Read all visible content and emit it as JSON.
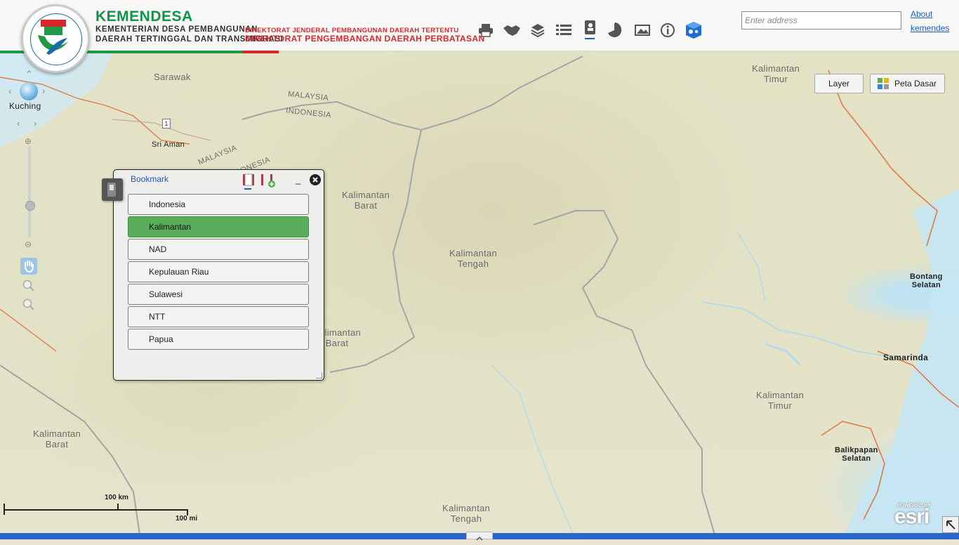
{
  "header": {
    "brand_title": "KEMENDESA",
    "brand_line1": "KEMENTERIAN DESA PEMBANGUNAN",
    "brand_line2": "DAERAH TERTINGGAL DAN TRANSMIGRASI",
    "directorate_line1": "DIREKTORAT JENDERAL PEMBANGUNAN DAERAH TERTENTU",
    "directorate_line2": "DIREKTORAT PENGEMBANGAN DAERAH PERBATASAN",
    "stripe_colors": [
      "#1e9a47",
      "#d9262c"
    ],
    "toolbar": [
      {
        "icon": "print-icon"
      },
      {
        "icon": "handshake-icon"
      },
      {
        "icon": "layers-icon"
      },
      {
        "icon": "list-icon"
      },
      {
        "icon": "bookmark-icon",
        "active": true
      },
      {
        "icon": "pie-chart-icon"
      },
      {
        "icon": "basemap-gallery-icon"
      },
      {
        "icon": "info-icon"
      },
      {
        "icon": "settings-cube-icon"
      }
    ],
    "address_placeholder": "Enter address",
    "about_line1": "About",
    "about_line2": "kemendes"
  },
  "map_buttons": {
    "layer": "Layer",
    "basemap": "Peta Dasar"
  },
  "bookmark_panel": {
    "title": "Bookmark",
    "minimize_label": "_",
    "items": [
      "Indonesia",
      "Kalimantan",
      "NAD",
      "Kepulauan Riau",
      "Sulawesi",
      "NTT",
      "Papua"
    ],
    "selected": "Kalimantan"
  },
  "map_labels": {
    "sarawak": "Sarawak",
    "kuching": "Kuching",
    "sri_aman": "Sri Aman",
    "malaysia_1": "MALAYSIA",
    "indonesia_1": "INDONESIA",
    "malaysia_2": "MALAYSIA",
    "indonesia_2": "INDONESIA",
    "road_1": "1",
    "kal_barat_1a": "Kalimantan",
    "kal_barat_1b": "Barat",
    "kal_tengah_1a": "Kalimantan",
    "kal_tengah_1b": "Tengah",
    "kal_barat_2a": "Kalimantan",
    "kal_barat_2b": "Barat",
    "kal_barat_3a": "Kalimantan",
    "kal_barat_3b": "Barat",
    "kal_timur_1a": "Kalimantan",
    "kal_timur_1b": "Timur",
    "kal_timur_2a": "Kalimantan",
    "kal_timur_2b": "Timur",
    "kal_tengah_2a": "Kalimantan",
    "kal_tengah_2b": "Tengah",
    "bontang_a": "Bontang",
    "bontang_b": "Selatan",
    "samarinda": "Samarinda",
    "balikpapan_a": "Balikpapan",
    "balikpapan_b": "Selatan"
  },
  "scale": {
    "km": "100 km",
    "mi": "100 mi"
  },
  "esri": {
    "powered": "POWERED BY",
    "name": "esri"
  }
}
